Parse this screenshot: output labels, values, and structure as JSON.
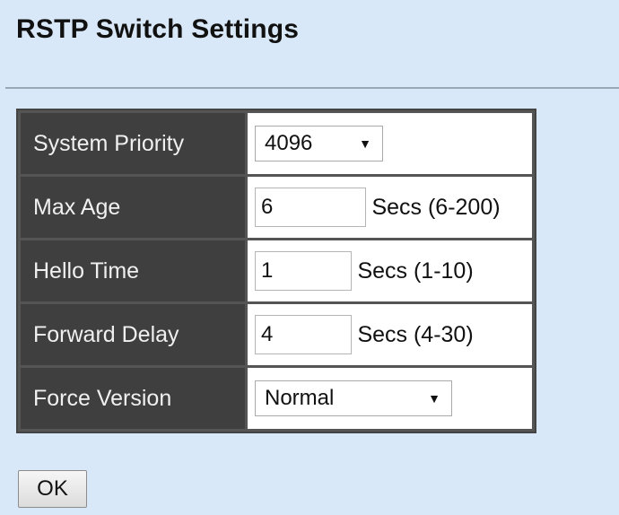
{
  "page": {
    "title": "RSTP Switch Settings"
  },
  "settings": {
    "system_priority": {
      "label": "System Priority",
      "value": "4096"
    },
    "max_age": {
      "label": "Max Age",
      "value": "6",
      "range": "Secs (6-200)"
    },
    "hello_time": {
      "label": "Hello Time",
      "value": "1",
      "range": "Secs (1-10)"
    },
    "forward_delay": {
      "label": "Forward Delay",
      "value": "4",
      "range": "Secs (4-30)"
    },
    "force_version": {
      "label": "Force Version",
      "value": "Normal"
    }
  },
  "actions": {
    "ok_label": "OK"
  },
  "icons": {
    "dropdown": "chevron-down-icon"
  },
  "colors": {
    "page_background": "#d9e8f8",
    "label_background": "#3f3f3f",
    "label_text": "#f0f0f0"
  }
}
